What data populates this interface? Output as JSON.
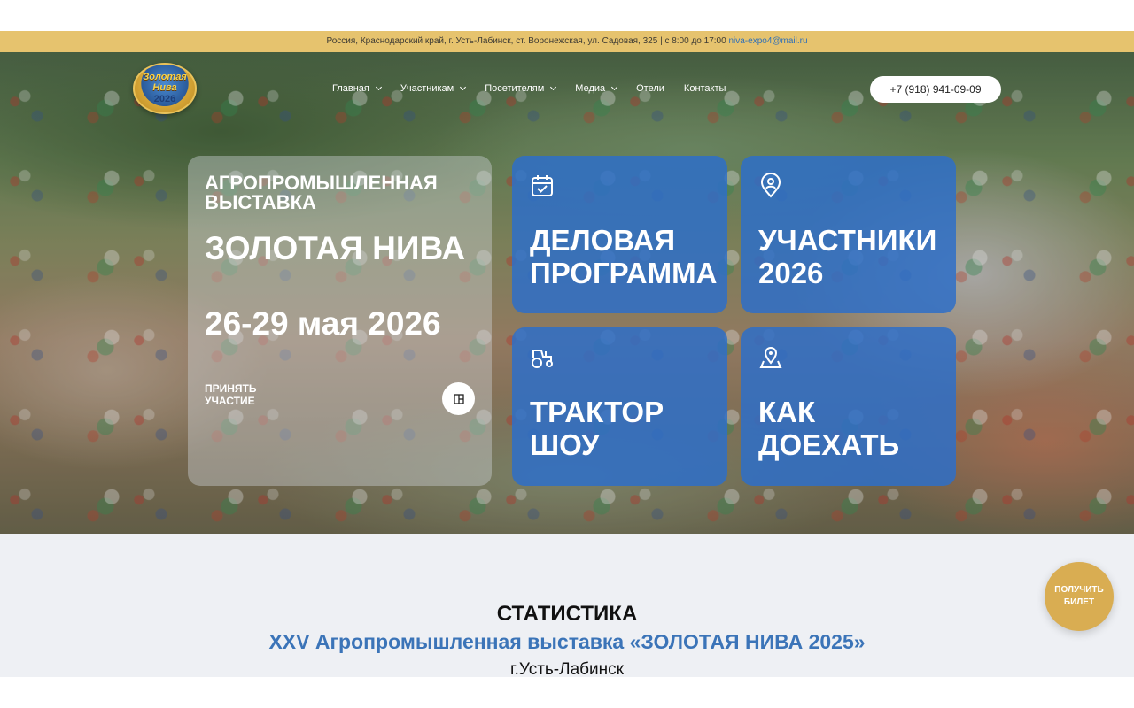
{
  "topbar": {
    "address": "Россия, Краснодарский край, г. Усть-Лабинск, ст. Воронежская, ул. Садовая, 325 | с 8:00 до 17:00",
    "email": "niva-expo4@mail.ru"
  },
  "logo": {
    "line1": "Золотая",
    "line2": "Нива",
    "year": "2026"
  },
  "nav": [
    {
      "label": "Главная",
      "has_dropdown": true
    },
    {
      "label": "Участникам",
      "has_dropdown": true
    },
    {
      "label": "Посетителям",
      "has_dropdown": true
    },
    {
      "label": "Медиа",
      "has_dropdown": true
    },
    {
      "label": "Отели",
      "has_dropdown": false
    },
    {
      "label": "Контакты",
      "has_dropdown": false
    }
  ],
  "phone": "+7 (918) 941-09-09",
  "hero": {
    "subtitle": "АГРОПРОМЫШЛЕННАЯ ВЫСТАВКА",
    "title": "ЗОЛОТАЯ НИВА",
    "dates": "26-29 мая 2026",
    "cta_line1": "ПРИНЯТЬ",
    "cta_line2": "УЧАСТИЕ"
  },
  "tiles": [
    {
      "line1": "ДЕЛОВАЯ",
      "line2": "ПРОГРАММА",
      "icon": "calendar-check-icon"
    },
    {
      "line1": "УЧАСТНИКИ",
      "line2": "2026",
      "icon": "location-person-icon"
    },
    {
      "line1": "ТРАКТОР",
      "line2": "ШОУ",
      "icon": "tractor-icon"
    },
    {
      "line1": "КАК",
      "line2": "ДОЕХАТЬ",
      "icon": "map-pin-icon"
    }
  ],
  "stats": {
    "heading": "СТАТИСТИКА",
    "subheading": "XXV Агропромышленная выставка «ЗОЛОТАЯ НИВА 2025»",
    "city": "г.Усть-Лабинск"
  },
  "ticket": {
    "line1": "ПОЛУЧИТЬ",
    "line2": "БИЛЕТ"
  },
  "colors": {
    "gold": "#e6c36e",
    "tile_blue": "#2e6ec8",
    "link_blue": "#3b74b8",
    "ticket_gold": "#d9ad52"
  }
}
